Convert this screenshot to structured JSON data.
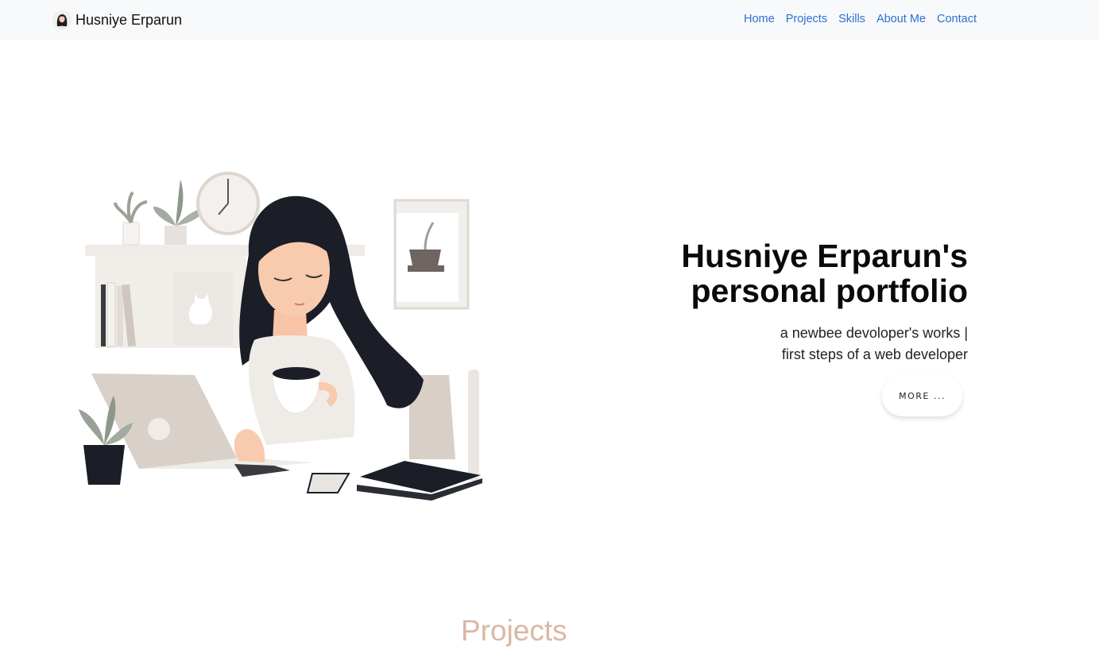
{
  "nav": {
    "brand": "Husniye Erparun",
    "brand_logo_icon": "woman-avatar-icon",
    "links": [
      "Home",
      "Projects",
      "Skills",
      "About Me",
      "Contact"
    ],
    "link_color": "#2f6fd6"
  },
  "hero": {
    "title_line1": "Husniye Erparun's",
    "title_line2": "personal portfolio",
    "subtitle_line1": "a newbee devoloper's works |",
    "subtitle_line2": "first steps of a web developer",
    "button_label": "MORE ...",
    "illustration_icon": "woman-with-laptop-illustration"
  },
  "sections": {
    "projects_title": "Projects",
    "accent_color": "#d9b8a4"
  }
}
